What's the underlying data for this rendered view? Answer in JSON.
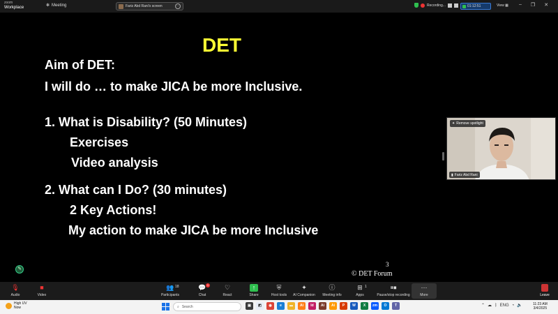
{
  "titlebar": {
    "brand_top": "zoom",
    "brand_bottom": "Workplace",
    "meeting_label": "Meeting",
    "share_label": "Fariz Abd Rani's screen",
    "recording_label": "Recording...",
    "timer": "01:12:51",
    "view_label": "View",
    "window_buttons": [
      "–",
      "❐",
      "✕"
    ]
  },
  "slide": {
    "title": "DET",
    "lines": [
      "Aim of DET:",
      "I will do … to make JICA be more Inclusive.",
      "1. What is Disability? (50 Minutes)",
      "Exercises",
      "Video analysis",
      "2. What can I Do? (30 minutes)",
      "2 Key Actions!",
      "My action to make JICA be more Inclusive"
    ],
    "page_number": "3",
    "footer": "©  DET Forum"
  },
  "video": {
    "spotlight_label": "Remove spotlight",
    "participant_name": "Fariz Abd Rani"
  },
  "toolbar": {
    "audio": "Audio",
    "video": "Video",
    "participants": "Participants",
    "participants_count": "18",
    "chat": "Chat",
    "chat_badge": "1",
    "react": "React",
    "share": "Share",
    "host_tools": "Host tools",
    "ai_companion": "AI Companion",
    "meeting_info": "Meeting info",
    "apps": "Apps",
    "apps_count": "1",
    "pause_recording": "Pause/stop recording",
    "more": "More",
    "leave": "Leave"
  },
  "taskbar": {
    "weather_title": "High UV",
    "weather_sub": "Now",
    "search_placeholder": "Search",
    "language": "ENG",
    "time": "11:23 AM",
    "date": "3/4/2025"
  },
  "colors": {
    "title_yellow": "#ffff33",
    "slide_bg": "#000000",
    "record_red": "#e33333",
    "timer_blue": "#153a6b"
  }
}
